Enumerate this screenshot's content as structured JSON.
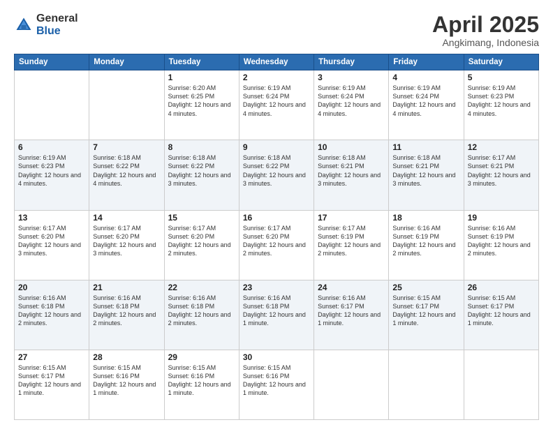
{
  "logo": {
    "general": "General",
    "blue": "Blue"
  },
  "title": "April 2025",
  "subtitle": "Angkimang, Indonesia",
  "headers": [
    "Sunday",
    "Monday",
    "Tuesday",
    "Wednesday",
    "Thursday",
    "Friday",
    "Saturday"
  ],
  "weeks": [
    [
      {
        "day": "",
        "info": ""
      },
      {
        "day": "",
        "info": ""
      },
      {
        "day": "1",
        "info": "Sunrise: 6:20 AM\nSunset: 6:25 PM\nDaylight: 12 hours\nand 4 minutes."
      },
      {
        "day": "2",
        "info": "Sunrise: 6:19 AM\nSunset: 6:24 PM\nDaylight: 12 hours\nand 4 minutes."
      },
      {
        "day": "3",
        "info": "Sunrise: 6:19 AM\nSunset: 6:24 PM\nDaylight: 12 hours\nand 4 minutes."
      },
      {
        "day": "4",
        "info": "Sunrise: 6:19 AM\nSunset: 6:24 PM\nDaylight: 12 hours\nand 4 minutes."
      },
      {
        "day": "5",
        "info": "Sunrise: 6:19 AM\nSunset: 6:23 PM\nDaylight: 12 hours\nand 4 minutes."
      }
    ],
    [
      {
        "day": "6",
        "info": "Sunrise: 6:19 AM\nSunset: 6:23 PM\nDaylight: 12 hours\nand 4 minutes."
      },
      {
        "day": "7",
        "info": "Sunrise: 6:18 AM\nSunset: 6:22 PM\nDaylight: 12 hours\nand 4 minutes."
      },
      {
        "day": "8",
        "info": "Sunrise: 6:18 AM\nSunset: 6:22 PM\nDaylight: 12 hours\nand 3 minutes."
      },
      {
        "day": "9",
        "info": "Sunrise: 6:18 AM\nSunset: 6:22 PM\nDaylight: 12 hours\nand 3 minutes."
      },
      {
        "day": "10",
        "info": "Sunrise: 6:18 AM\nSunset: 6:21 PM\nDaylight: 12 hours\nand 3 minutes."
      },
      {
        "day": "11",
        "info": "Sunrise: 6:18 AM\nSunset: 6:21 PM\nDaylight: 12 hours\nand 3 minutes."
      },
      {
        "day": "12",
        "info": "Sunrise: 6:17 AM\nSunset: 6:21 PM\nDaylight: 12 hours\nand 3 minutes."
      }
    ],
    [
      {
        "day": "13",
        "info": "Sunrise: 6:17 AM\nSunset: 6:20 PM\nDaylight: 12 hours\nand 3 minutes."
      },
      {
        "day": "14",
        "info": "Sunrise: 6:17 AM\nSunset: 6:20 PM\nDaylight: 12 hours\nand 3 minutes."
      },
      {
        "day": "15",
        "info": "Sunrise: 6:17 AM\nSunset: 6:20 PM\nDaylight: 12 hours\nand 2 minutes."
      },
      {
        "day": "16",
        "info": "Sunrise: 6:17 AM\nSunset: 6:20 PM\nDaylight: 12 hours\nand 2 minutes."
      },
      {
        "day": "17",
        "info": "Sunrise: 6:17 AM\nSunset: 6:19 PM\nDaylight: 12 hours\nand 2 minutes."
      },
      {
        "day": "18",
        "info": "Sunrise: 6:16 AM\nSunset: 6:19 PM\nDaylight: 12 hours\nand 2 minutes."
      },
      {
        "day": "19",
        "info": "Sunrise: 6:16 AM\nSunset: 6:19 PM\nDaylight: 12 hours\nand 2 minutes."
      }
    ],
    [
      {
        "day": "20",
        "info": "Sunrise: 6:16 AM\nSunset: 6:18 PM\nDaylight: 12 hours\nand 2 minutes."
      },
      {
        "day": "21",
        "info": "Sunrise: 6:16 AM\nSunset: 6:18 PM\nDaylight: 12 hours\nand 2 minutes."
      },
      {
        "day": "22",
        "info": "Sunrise: 6:16 AM\nSunset: 6:18 PM\nDaylight: 12 hours\nand 2 minutes."
      },
      {
        "day": "23",
        "info": "Sunrise: 6:16 AM\nSunset: 6:18 PM\nDaylight: 12 hours\nand 1 minute."
      },
      {
        "day": "24",
        "info": "Sunrise: 6:16 AM\nSunset: 6:17 PM\nDaylight: 12 hours\nand 1 minute."
      },
      {
        "day": "25",
        "info": "Sunrise: 6:15 AM\nSunset: 6:17 PM\nDaylight: 12 hours\nand 1 minute."
      },
      {
        "day": "26",
        "info": "Sunrise: 6:15 AM\nSunset: 6:17 PM\nDaylight: 12 hours\nand 1 minute."
      }
    ],
    [
      {
        "day": "27",
        "info": "Sunrise: 6:15 AM\nSunset: 6:17 PM\nDaylight: 12 hours\nand 1 minute."
      },
      {
        "day": "28",
        "info": "Sunrise: 6:15 AM\nSunset: 6:16 PM\nDaylight: 12 hours\nand 1 minute."
      },
      {
        "day": "29",
        "info": "Sunrise: 6:15 AM\nSunset: 6:16 PM\nDaylight: 12 hours\nand 1 minute."
      },
      {
        "day": "30",
        "info": "Sunrise: 6:15 AM\nSunset: 6:16 PM\nDaylight: 12 hours\nand 1 minute."
      },
      {
        "day": "",
        "info": ""
      },
      {
        "day": "",
        "info": ""
      },
      {
        "day": "",
        "info": ""
      }
    ]
  ]
}
